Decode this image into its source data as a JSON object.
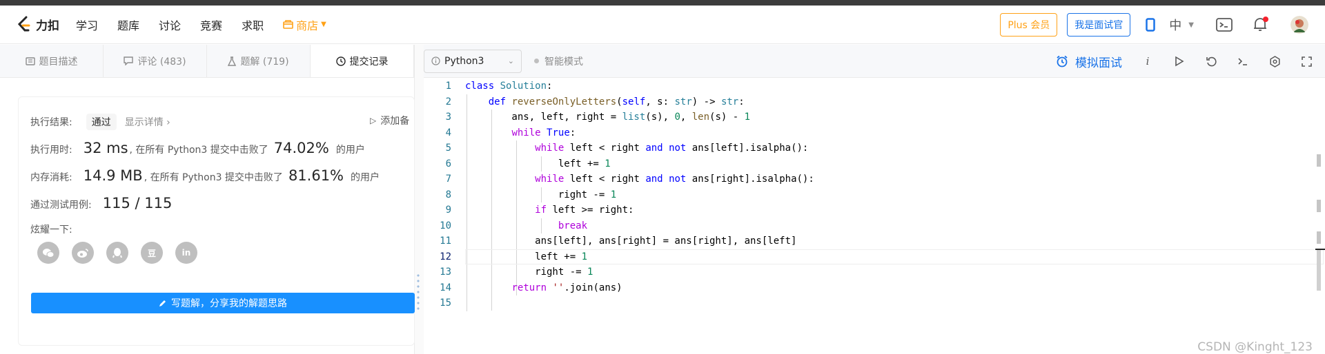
{
  "nav": {
    "logo_text": "力扣",
    "links": [
      "学习",
      "题库",
      "讨论",
      "竞赛",
      "求职"
    ],
    "shop": "商店",
    "plus": "Plus 会员",
    "interviewer": "我是面试官",
    "lang": "中"
  },
  "tabs": {
    "description": "题目描述",
    "comments": "评论 (483)",
    "solutions": "题解 (719)",
    "submissions": "提交记录"
  },
  "result": {
    "label_result": "执行结果:",
    "status": "通过",
    "details": "显示详情",
    "add_note": "添加备",
    "label_time": "执行用时:",
    "time_value": "32 ms",
    "time_mid": ", 在所有 Python3 提交中击败了",
    "time_pct": "74.02%",
    "time_tail": "的用户",
    "label_mem": "内存消耗:",
    "mem_value": "14.9 MB",
    "mem_mid": ", 在所有 Python3 提交中击败了",
    "mem_pct": "81.61%",
    "mem_tail": "的用户",
    "label_tests": "通过测试用例:",
    "tests_value": "115 / 115",
    "label_share": "炫耀一下:",
    "share_icons": [
      "wechat-icon",
      "weibo-icon",
      "qq-icon",
      "douban-icon",
      "linkedin-icon"
    ],
    "douban_glyph": "豆",
    "linkedin_glyph": "in",
    "write_btn": "写题解，分享我的解题思路"
  },
  "editor": {
    "language": "Python3",
    "smart_mode": "智能模式",
    "mock_interview": "模拟面试",
    "info_glyph": "i",
    "current_line": 12,
    "line_numbers": [
      "1",
      "2",
      "3",
      "4",
      "5",
      "6",
      "7",
      "8",
      "9",
      "10",
      "11",
      "12",
      "13",
      "14",
      "15"
    ]
  },
  "watermark": "CSDN @Kinght_123",
  "colors": {
    "accent": "#1a73e8",
    "orange": "#ffa116",
    "primary_button": "#1890ff"
  }
}
